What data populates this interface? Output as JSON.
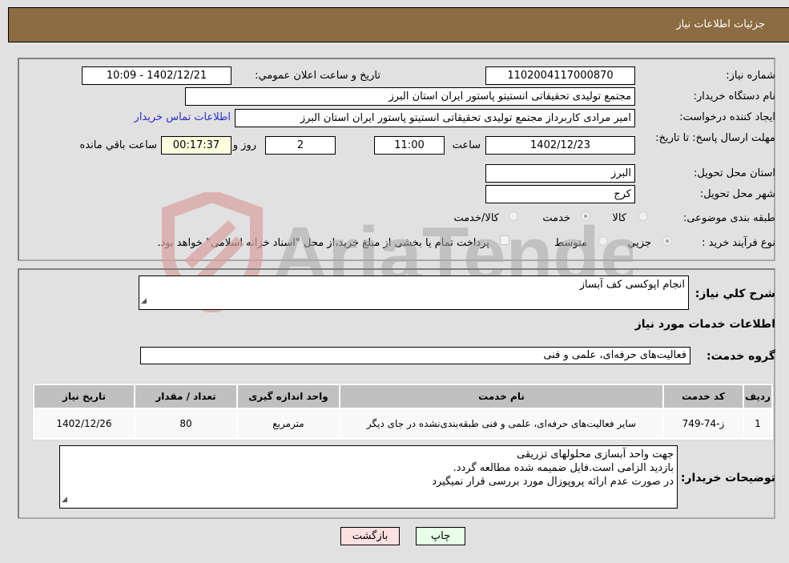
{
  "header": {
    "title": "جزئیات اطلاعات نیاز"
  },
  "fields": {
    "need_number_label": "شماره نیاز:",
    "need_number": "1102004117000870",
    "announce_label": "تاريخ و ساعت اعلان عمومي:",
    "announce_value": "1402/12/21 - 10:09",
    "buyer_org_label": "نام دستگاه خریدار:",
    "buyer_org": "مجتمع تولیدی تحقیقاتی انستیتو پاستور ایران استان البرز",
    "requester_label": "ایجاد کننده درخواست:",
    "requester": "امیر مرادی کاربرداز مجتمع تولیدی تحقیقاتی انستیتو پاستور ایران استان البرز",
    "contact_link": "اطلاعات تماس خریدار",
    "deadline_label": "مهلت ارسال پاسخ: تا تاریخ:",
    "deadline_date": "1402/12/23",
    "time_label": "ساعت",
    "deadline_time": "11:00",
    "days": "2",
    "days_label": "روز و",
    "remaining": "00:17:37",
    "remaining_label": "ساعت باقي مانده",
    "province_label": "استان محل تحویل:",
    "province": "البرز",
    "city_label": "شهر محل تحویل:",
    "city": "کرج",
    "category_label": "طبقه بندی موضوعی:",
    "category_options": [
      "کالا",
      "خدمت",
      "کالا/خدمت"
    ],
    "category_selected": "خدمت",
    "purchase_type_label": "نوع فرآیند خرید :",
    "purchase_options": [
      "جزيي",
      "متوسط"
    ],
    "purchase_selected": "جزيي",
    "treasury_note": "پرداخت تمام یا بخشی از مبلغ خرید،از محل \"اسناد خزانه اسلامی\" خواهد بود."
  },
  "details": {
    "summary_label": "شرح کلي نياز:",
    "summary": "انجام اپوکسی کف آبساز",
    "services_heading": "اطلاعات خدمات مورد نیاز",
    "service_group_label": "گروه خدمت:",
    "service_group": "فعالیت‌های حرفه‌ای، علمی و فنی"
  },
  "table": {
    "headers": [
      "ردیف",
      "کد خدمت",
      "نام خدمت",
      "واحد اندازه گیری",
      "تعداد / مقدار",
      "تاریخ نیاز"
    ],
    "rows": [
      [
        "1",
        "ز-74-749",
        "سایر فعالیت‌های حرفه‌ای، علمی و فنی طبقه‌بندی‌نشده در جای دیگر",
        "مترمربع",
        "80",
        "1402/12/26"
      ]
    ]
  },
  "buyer_notes": {
    "label": "توضیحات خریدار:",
    "lines": [
      "جهت واحد آبسازی محلولهای  تزریقی",
      "بازدید الزامی است.فایل ضمیمه شده مطالعه گردد.",
      "در صورت عدم ارائه پروپوزال مورد بررسی قرار نمیگیرد"
    ]
  },
  "buttons": {
    "print": "چاپ",
    "back": "بازگشت"
  },
  "watermark": {
    "text": "AriaTender.neT"
  },
  "colors": {
    "header_bg": "#8c6c42",
    "print_bg": "#e8ffe8",
    "back_bg": "#ffe0e0",
    "link": "#2b2bd0"
  }
}
